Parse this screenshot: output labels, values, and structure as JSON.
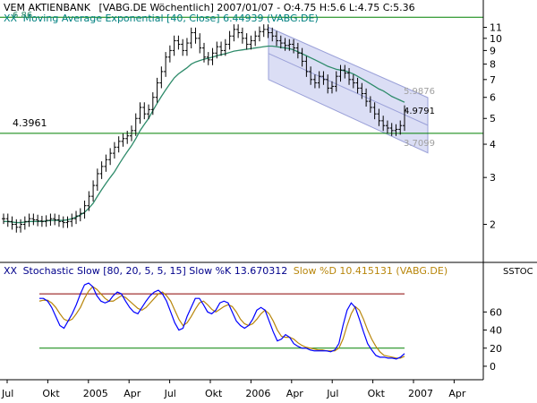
{
  "colors": {
    "price": "#000000",
    "ema": "#2e8b6a",
    "channel_fill": "#d2d6f2",
    "channel_line": "#9aa0d8",
    "hline": "#008000",
    "slowK": "#0000ff",
    "slowD": "#b8860b",
    "stoch_upper": "#8b0000",
    "stoch_lower": "#008000",
    "label_gray": "#a0a0a0",
    "title_black": "#000000",
    "title_green": "#008080",
    "title_blue": "#00008b"
  },
  "chart_data": [
    {
      "type": "candlestick",
      "title": "VEM AKTIENBANK",
      "ticker_info": "[VABG.DE  Wöchentlich] 2007/01/07 - O:4.75 H:5.6 L:4.75 C:5.36",
      "indicator_legend": "Moving Average Exponential [40, Close] 6.44939 (VABG.DE)",
      "indicator_prefix": "XX",
      "top_left_value": "6.86",
      "y_scale": "log",
      "ylim": [
        1.45,
        12.5
      ],
      "y_ticks": [
        11,
        10,
        9,
        8,
        7,
        6,
        5,
        4,
        3,
        2
      ],
      "x_labels": [
        "Jul",
        "Okt",
        "2005",
        "Apr",
        "Jul",
        "Okt",
        "2006",
        "Apr",
        "Jul",
        "Okt",
        "2007",
        "Apr"
      ],
      "horizontal_lines": [
        {
          "value": 12.0,
          "label": ""
        },
        {
          "value": 4.3961,
          "label": "4.3961"
        }
      ],
      "channel": {
        "start": {
          "x": "2006-02",
          "upper": 11.0,
          "lower": 7.0
        },
        "end": {
          "x": "2007-02",
          "upper": 5.9876,
          "lower": 3.7099
        },
        "labels": [
          "5.9876",
          "3.7099"
        ]
      },
      "last_value_label": "4.9791",
      "weekly_close": [
        2.1,
        2.05,
        2.0,
        1.95,
        2.0,
        2.05,
        2.1,
        2.08,
        2.06,
        2.05,
        2.07,
        2.1,
        2.08,
        2.05,
        2.03,
        2.05,
        2.1,
        2.15,
        2.2,
        2.35,
        2.55,
        2.8,
        3.1,
        3.3,
        3.5,
        3.7,
        3.9,
        4.1,
        4.2,
        4.3,
        4.5,
        5.0,
        5.5,
        5.2,
        5.4,
        6.0,
        6.8,
        7.5,
        8.5,
        9.0,
        9.8,
        9.5,
        9.0,
        9.6,
        10.5,
        10.0,
        9.2,
        8.5,
        8.3,
        8.8,
        9.3,
        9.0,
        9.5,
        10.2,
        10.8,
        10.5,
        10.0,
        9.5,
        9.8,
        10.2,
        10.6,
        10.8,
        10.5,
        10.2,
        9.8,
        9.6,
        9.4,
        9.5,
        9.2,
        8.8,
        8.2,
        7.5,
        7.0,
        6.8,
        7.2,
        7.0,
        6.5,
        6.6,
        7.2,
        7.6,
        7.4,
        7.0,
        6.8,
        6.5,
        6.2,
        5.8,
        5.5,
        5.2,
        4.9,
        4.7,
        4.6,
        4.5,
        4.55,
        4.7,
        5.36
      ],
      "ema": [
        2.05,
        2.05,
        2.04,
        2.03,
        2.03,
        2.04,
        2.05,
        2.05,
        2.05,
        2.05,
        2.06,
        2.07,
        2.07,
        2.07,
        2.07,
        2.08,
        2.1,
        2.13,
        2.17,
        2.22,
        2.3,
        2.4,
        2.55,
        2.7,
        2.85,
        3.0,
        3.15,
        3.35,
        3.55,
        3.75,
        3.95,
        4.2,
        4.5,
        4.75,
        5.0,
        5.35,
        5.7,
        6.05,
        6.4,
        6.75,
        7.1,
        7.35,
        7.55,
        7.75,
        8.0,
        8.15,
        8.25,
        8.35,
        8.42,
        8.5,
        8.6,
        8.68,
        8.75,
        8.85,
        8.95,
        9.0,
        9.05,
        9.1,
        9.15,
        9.2,
        9.25,
        9.3,
        9.35,
        9.35,
        9.3,
        9.25,
        9.2,
        9.15,
        9.05,
        8.9,
        8.75,
        8.6,
        8.45,
        8.3,
        8.15,
        8.0,
        7.85,
        7.75,
        7.65,
        7.6,
        7.55,
        7.45,
        7.35,
        7.2,
        7.05,
        6.9,
        6.75,
        6.6,
        6.45,
        6.35,
        6.2,
        6.05,
        5.95,
        5.85,
        5.75
      ]
    },
    {
      "type": "line",
      "legend_prefix": "XX",
      "legend_text": "Stochastic Slow [80, 20, 5, 5, 15] Slow %K 13.670312",
      "legend_text_d": "Slow %D 10.415131 (VABG.DE)",
      "right_label": "SSTOC",
      "ylim": [
        -5,
        95
      ],
      "y_ticks": [
        60,
        40,
        20,
        0
      ],
      "hlines": [
        80,
        20
      ],
      "series": [
        {
          "name": "Slow %K",
          "values": [
            75,
            75,
            72,
            65,
            55,
            45,
            42,
            50,
            58,
            68,
            80,
            90,
            92,
            88,
            78,
            72,
            70,
            72,
            78,
            82,
            80,
            72,
            65,
            60,
            58,
            65,
            72,
            78,
            82,
            84,
            80,
            72,
            60,
            48,
            40,
            42,
            55,
            65,
            75,
            75,
            68,
            60,
            58,
            62,
            70,
            72,
            70,
            60,
            50,
            45,
            42,
            45,
            52,
            62,
            65,
            62,
            50,
            38,
            28,
            30,
            35,
            32,
            25,
            22,
            20,
            20,
            18,
            17,
            17,
            17,
            17,
            16,
            18,
            25,
            45,
            62,
            70,
            65,
            52,
            38,
            25,
            18,
            12,
            10,
            10,
            9,
            9,
            8,
            10,
            14
          ]
        },
        {
          "name": "Slow %D",
          "values": [
            72,
            73,
            73,
            70,
            65,
            58,
            52,
            50,
            52,
            58,
            65,
            75,
            83,
            88,
            85,
            80,
            75,
            72,
            72,
            75,
            78,
            76,
            72,
            68,
            64,
            62,
            65,
            70,
            75,
            80,
            82,
            78,
            72,
            62,
            52,
            45,
            48,
            55,
            63,
            70,
            72,
            68,
            63,
            60,
            63,
            66,
            68,
            66,
            60,
            52,
            47,
            45,
            47,
            52,
            58,
            62,
            58,
            50,
            40,
            33,
            32,
            32,
            30,
            26,
            23,
            21,
            20,
            19,
            18,
            18,
            17,
            17,
            17,
            20,
            30,
            45,
            58,
            66,
            62,
            52,
            40,
            30,
            22,
            16,
            12,
            11,
            10,
            9,
            9,
            11
          ]
        }
      ]
    }
  ]
}
